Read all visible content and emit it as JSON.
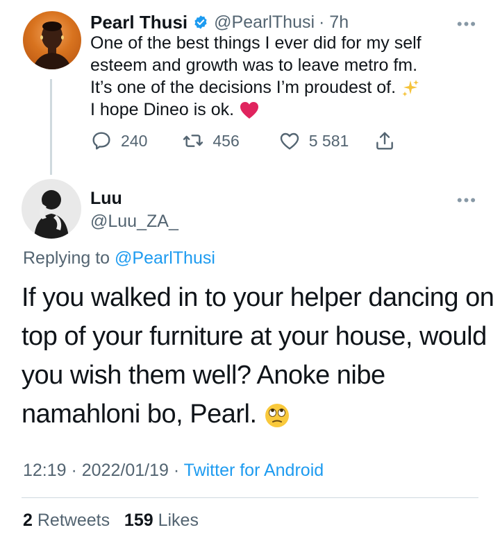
{
  "parent_tweet": {
    "author_name": "Pearl Thusi",
    "handle": "@PearlThusi",
    "time": "· 7h",
    "lines": [
      "One of the best things I ever did for my self",
      "esteem and growth was to leave metro fm.",
      "It’s one of the decisions I’m proudest of.",
      "I hope Dineo is ok."
    ],
    "replies": "240",
    "retweets": "456",
    "likes": "5 581"
  },
  "reply_tweet": {
    "author_name": "Luu",
    "handle": "@Luu_ZA_",
    "replying_prefix": "Replying to",
    "replying_to": "@PearlThusi",
    "lines": [
      "If you walked in to your helper dancing on",
      "top of your furniture at your house, would",
      "you wish them well? Anoke nibe",
      "namahloni bo, Pearl."
    ],
    "time": "12:19",
    "date": "2022/01/19",
    "source": "Twitter for Android",
    "retweets_count": "2",
    "retweets_label": "Retweets",
    "likes_count": "159",
    "likes_label": "Likes"
  },
  "icons": {
    "reply": "speech-bubble-icon",
    "retweet": "retweet-icon",
    "like": "heart-icon",
    "share": "share-icon",
    "verified": "verified-badge-icon",
    "more": "more-dots-icon"
  },
  "colors": {
    "accent": "#1d9bf0",
    "muted": "#536471",
    "text": "#0f1419",
    "heart_emoji": "#e0245e"
  }
}
